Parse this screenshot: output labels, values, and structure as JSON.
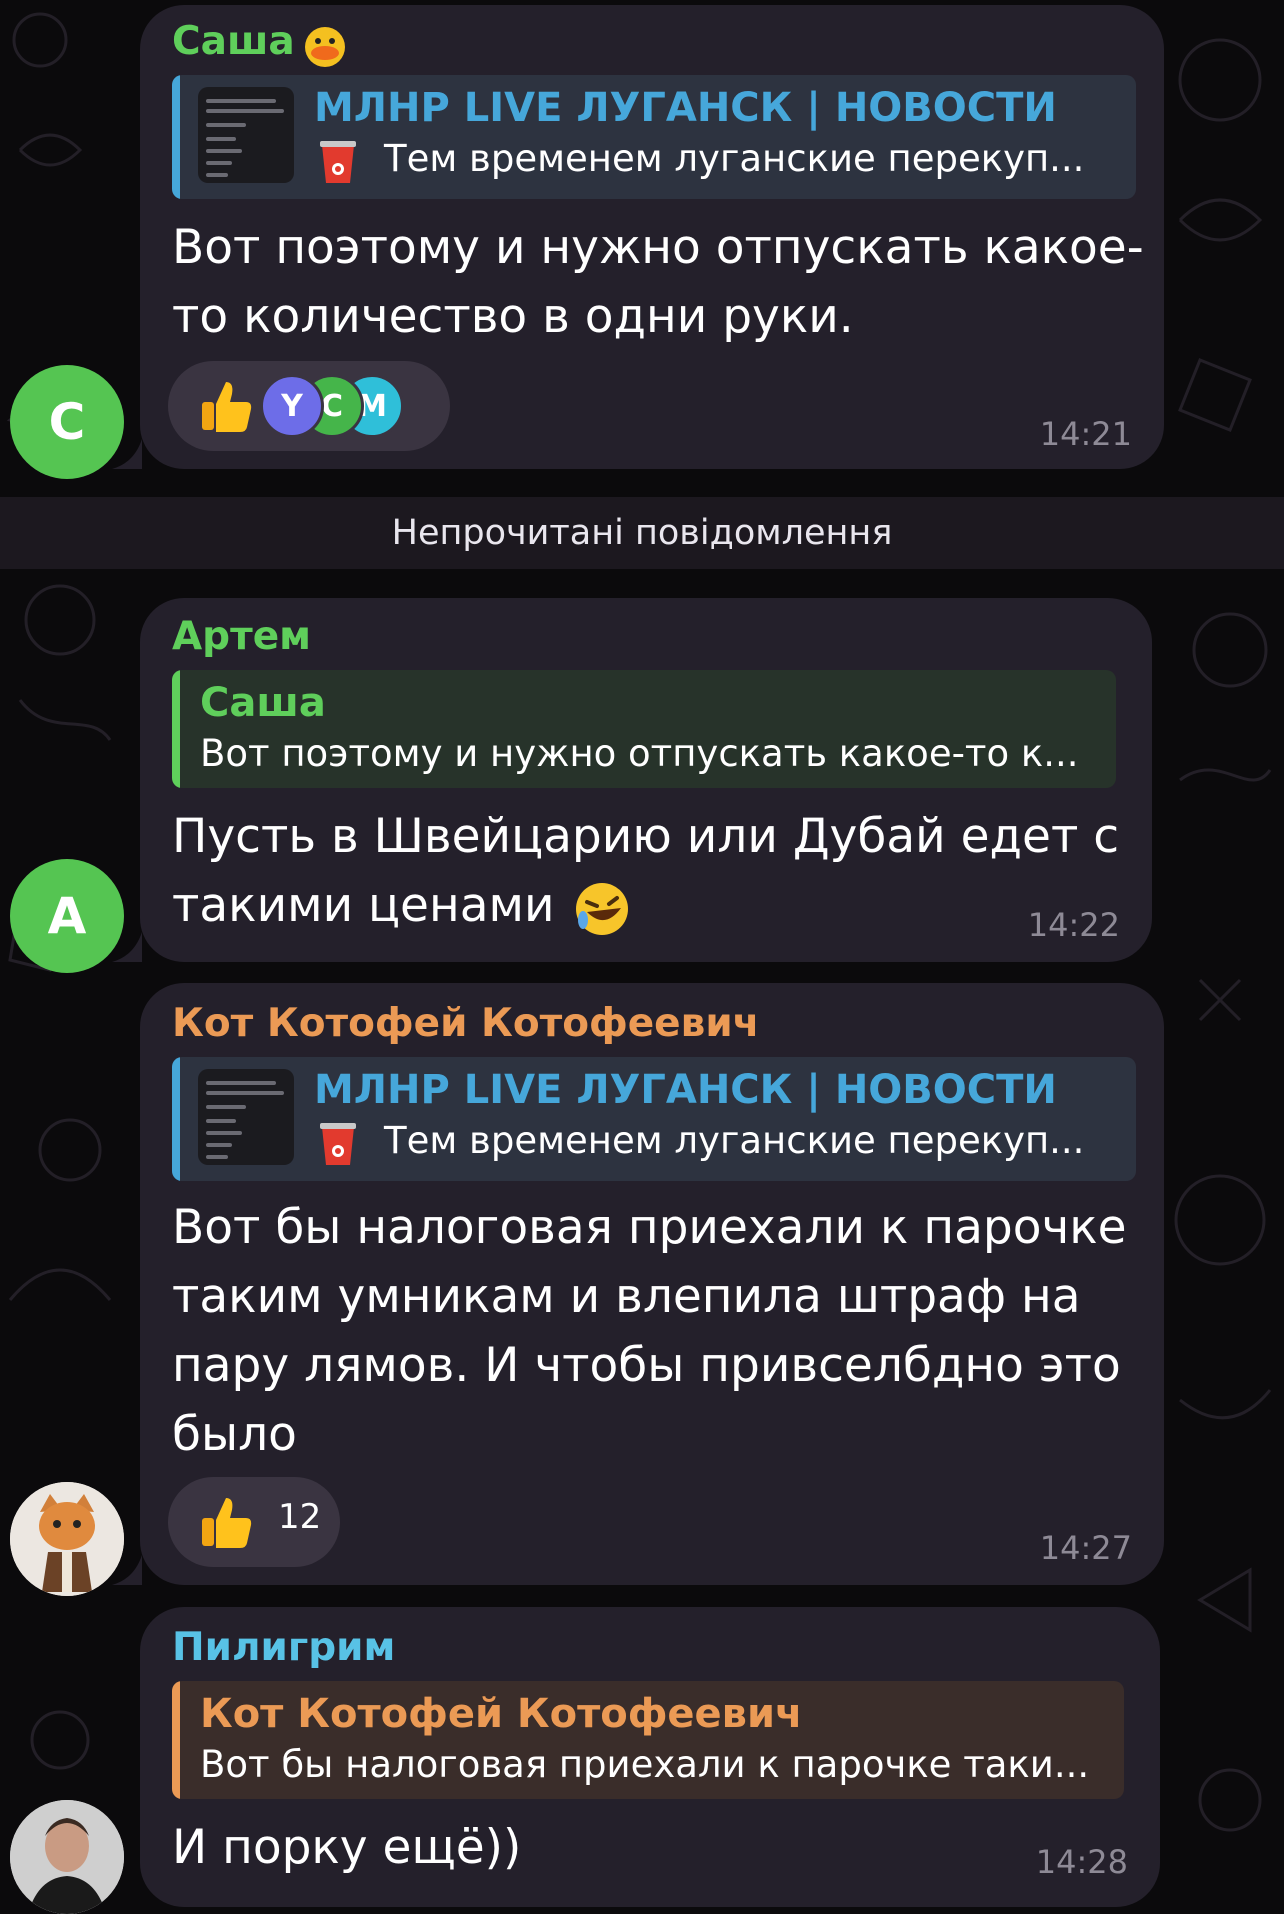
{
  "colors": {
    "bubble": "#24202b",
    "sender_sasha": "#5fcf5b",
    "sender_artem": "#5fcf5b",
    "sender_kot": "#eb9a55",
    "sender_piligrim": "#58c2e6",
    "channel_link": "#46a7da",
    "time": "#8e8a96"
  },
  "messages": [
    {
      "sender": "Саша",
      "sender_emoji": "duck-emoji",
      "reply": {
        "title": "МЛНР LIVE ЛУГАНСК | НОВОСТИ",
        "text": "Тем временем луганские перекуп...",
        "icon": "coffee-cup-icon"
      },
      "text_lines": [
        "Вот поэтому и нужно отпускать какое-",
        "то количество в одни руки."
      ],
      "reactions": {
        "emoji": "thumbs-up",
        "avatars": [
          "Y",
          "C",
          "M"
        ]
      },
      "time": "14:21",
      "avatar_letter": "С"
    },
    {
      "sender": "Артем",
      "reply": {
        "title": "Саша",
        "text": "Вот поэтому и нужно отпускать какое-то к..."
      },
      "text_lines": [
        "Пусть в Швейцарию или Дубай едет с",
        "такими ценами"
      ],
      "text_emoji": "rolling-laughing-emoji",
      "time": "14:22",
      "avatar_letter": "А"
    },
    {
      "sender": "Кот Котофей Котофеевич",
      "reply": {
        "title": "МЛНР LIVE ЛУГАНСК | НОВОСТИ",
        "text": "Тем временем луганские перекуп...",
        "icon": "coffee-cup-icon"
      },
      "text_lines": [
        "Вот бы налоговая приехали к парочке",
        "таким умникам и влепила штраф на",
        "пару лямов. И чтобы привселбдно это",
        "было"
      ],
      "reactions": {
        "emoji": "thumbs-up",
        "count": "12"
      },
      "time": "14:27",
      "avatar": "cat-avatar"
    },
    {
      "sender": "Пилигрим",
      "reply": {
        "title": "Кот Котофей Котофеевич",
        "text": "Вот бы налоговая приехали к парочке таки..."
      },
      "text_lines": [
        "И порку ещё))"
      ],
      "time": "14:28",
      "avatar": "man-photo-avatar"
    }
  ],
  "unread_divider": "Непрочитані повідомлення"
}
